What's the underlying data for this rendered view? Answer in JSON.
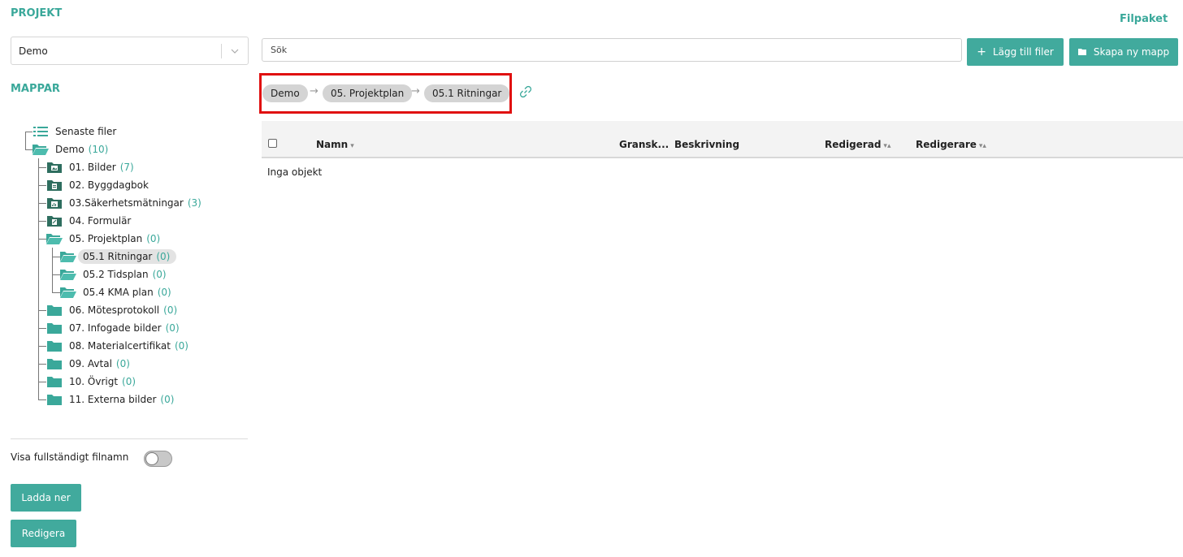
{
  "header": {
    "project_label": "PROJEKT",
    "filpaket_link": "Filpaket"
  },
  "project_select": {
    "value": "Demo"
  },
  "folders_label": "MAPPAR",
  "tree": [
    {
      "label": "Senaste filer",
      "count": ""
    },
    {
      "label": "Demo",
      "count": "(10)"
    },
    {
      "label": "01. Bilder",
      "count": "(7)"
    },
    {
      "label": "02. Byggdagbok",
      "count": ""
    },
    {
      "label": "03.Säkerhetsmätningar",
      "count": "(3)"
    },
    {
      "label": "04. Formulär",
      "count": ""
    },
    {
      "label": "05. Projektplan",
      "count": "(0)"
    },
    {
      "label": "05.1 Ritningar",
      "count": "(0)"
    },
    {
      "label": "05.2 Tidsplan",
      "count": "(0)"
    },
    {
      "label": "05.4 KMA plan",
      "count": "(0)"
    },
    {
      "label": "06. Mötesprotokoll",
      "count": "(0)"
    },
    {
      "label": "07. Infogade bilder",
      "count": "(0)"
    },
    {
      "label": "08. Materialcertifikat",
      "count": "(0)"
    },
    {
      "label": "09. Avtal",
      "count": "(0)"
    },
    {
      "label": "10. Övrigt",
      "count": "(0)"
    },
    {
      "label": "11. Externa bilder",
      "count": "(0)"
    }
  ],
  "sidebar_bottom": {
    "toggle_label": "Visa fullständigt filnamn",
    "toggle_on": false,
    "download_button": "Ladda ner",
    "edit_button": "Redigera"
  },
  "search": {
    "placeholder": "Sök"
  },
  "toolbar": {
    "add_files_button": "Lägg till filer",
    "new_folder_button": "Skapa ny mapp"
  },
  "breadcrumb": [
    "Demo",
    "05. Projektplan",
    "05.1 Ritningar"
  ],
  "table": {
    "columns": [
      "Namn",
      "Gransk...",
      "Beskrivning",
      "Redigerad",
      "Redigerare"
    ],
    "empty_text": "Inga objekt"
  },
  "colors": {
    "accent": "#41aa9d",
    "highlight": "#e01010",
    "folder_dark": "#2e6e5f"
  },
  "icons": [
    "list-icon",
    "folder-open-icon",
    "image-folder-icon",
    "document-folder-icon",
    "chart-folder-icon",
    "form-folder-icon",
    "folder-icon",
    "link-icon",
    "plus-icon",
    "chevron-down-icon"
  ]
}
